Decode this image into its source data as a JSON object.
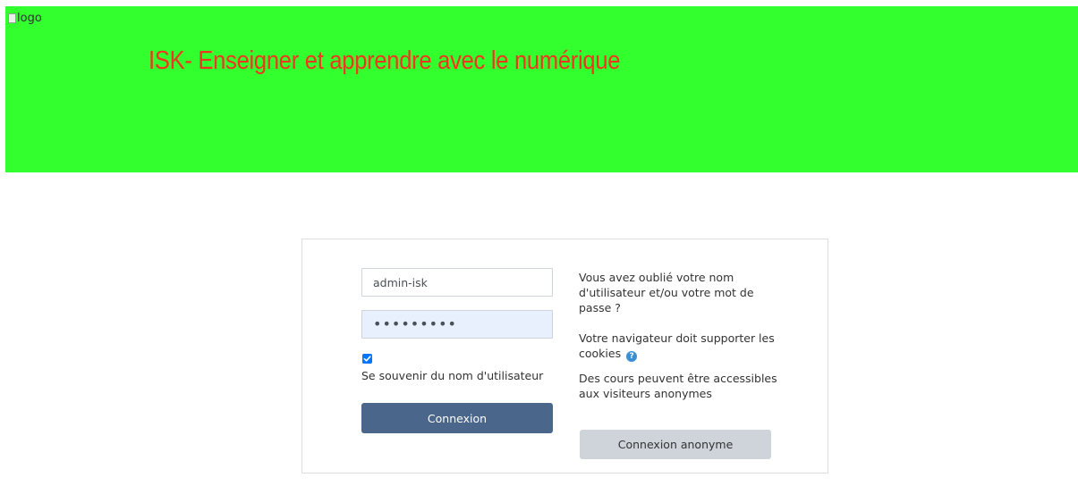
{
  "header": {
    "logo_alt": "logo",
    "site_title": "ISK- Enseigner et apprendre avec le numérique",
    "background_color": "#33ff2e",
    "title_color": "#f0361f"
  },
  "login": {
    "username_value": "admin-isk",
    "password_masked": "•••••••••",
    "remember_checked": true,
    "remember_label": "Se souvenir du nom d'utilisateur",
    "login_button_label": "Connexion",
    "login_button_color": "#4a668a"
  },
  "info": {
    "forgot_text": "Vous avez oublié votre nom d'utilisateur et/ou votre mot de passe ?",
    "cookies_text": "Votre navigateur doit supporter les cookies",
    "help_icon_glyph": "?",
    "guest_text": "Des cours peuvent être accessibles aux visiteurs anonymes",
    "guest_button_label": "Connexion anonyme"
  }
}
